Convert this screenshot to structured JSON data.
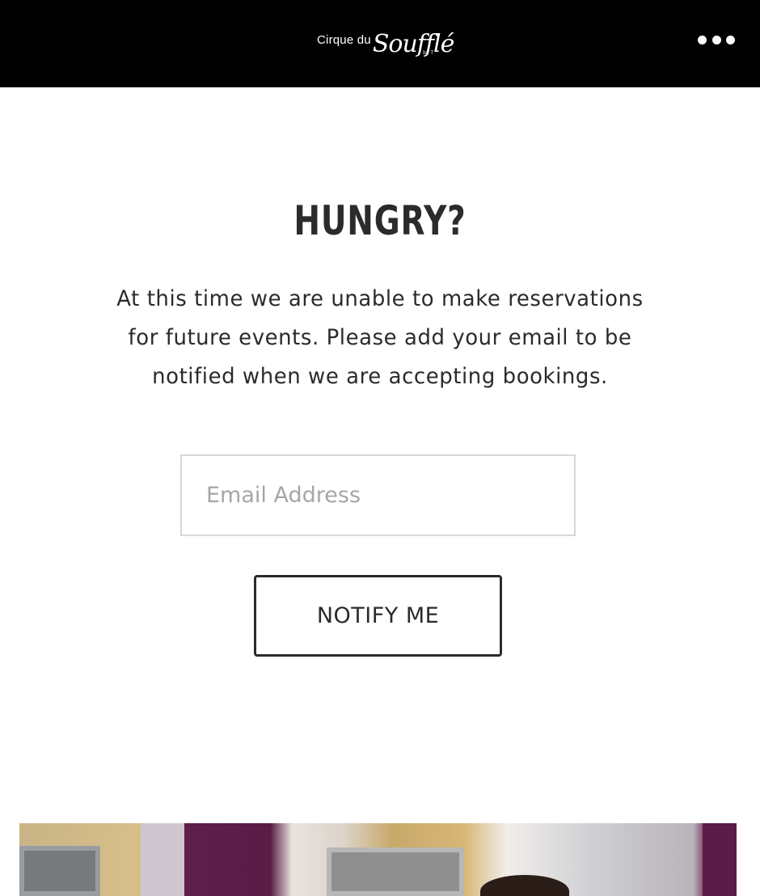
{
  "header": {
    "logo": {
      "small_text": "Cirque du",
      "script_text": "Soufflé",
      "byline": "by T"
    },
    "menu_icon": "more-dots-icon"
  },
  "main": {
    "title": "HUNGRY?",
    "message": "At this time we are unable to make reservations for future events. Please add your email to be notified when we are accepting bookings.",
    "email_placeholder": "Email Address",
    "email_value": "",
    "notify_label": "NOTIFY ME"
  },
  "colors": {
    "header_bg": "#000000",
    "text": "#2b2b2b",
    "input_border": "#d7d7d7",
    "placeholder": "#a6a6a6"
  }
}
